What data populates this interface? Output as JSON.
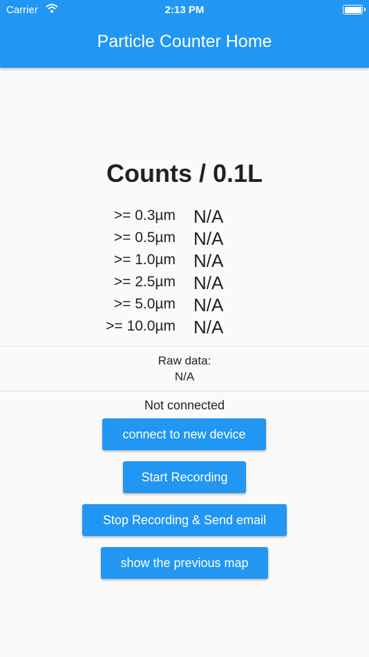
{
  "status_bar": {
    "carrier": "Carrier",
    "time": "2:13 PM"
  },
  "app_bar": {
    "title": "Particle Counter Home"
  },
  "counts": {
    "heading": "Counts / 0.1L",
    "rows": [
      {
        "label": ">= 0.3µm",
        "value": "N/A"
      },
      {
        "label": ">= 0.5µm",
        "value": "N/A"
      },
      {
        "label": ">= 1.0µm",
        "value": "N/A"
      },
      {
        "label": ">= 2.5µm",
        "value": "N/A"
      },
      {
        "label": ">= 5.0µm",
        "value": "N/A"
      },
      {
        "label": ">= 10.0µm",
        "value": "N/A"
      }
    ]
  },
  "raw": {
    "label": "Raw data:",
    "value": "N/A"
  },
  "connection": {
    "status": "Not connected"
  },
  "buttons": {
    "connect": "connect to new device",
    "start": "Start Recording",
    "stop": "Stop Recording & Send email",
    "map": "show the previous map"
  },
  "colors": {
    "primary": "#2196f3",
    "background": "#fafafa"
  },
  "icons": {
    "wifi": "wifi-icon",
    "battery": "battery-icon"
  }
}
